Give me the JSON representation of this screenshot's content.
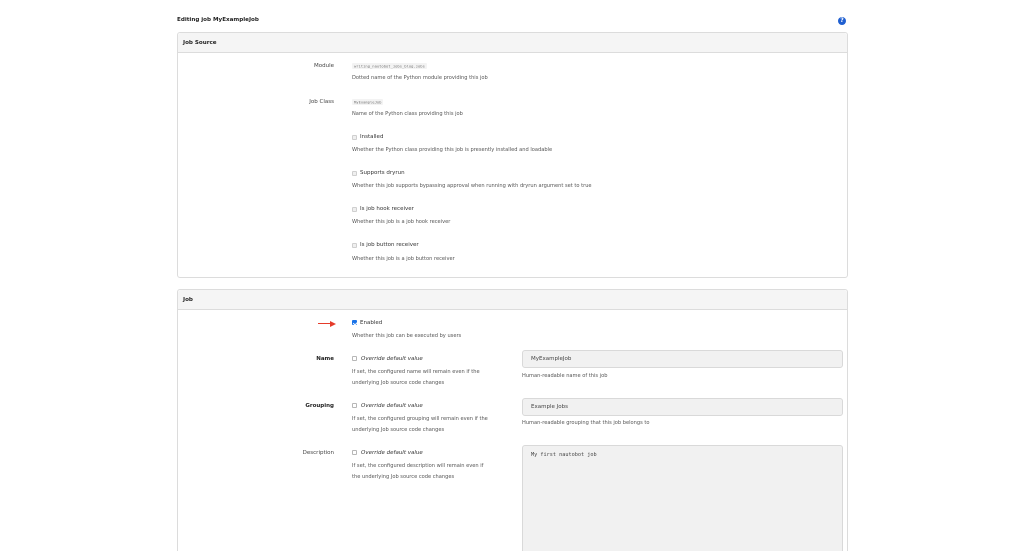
{
  "page": {
    "title": "Editing job MyExampleJob",
    "help_icon": "question-icon"
  },
  "job_source": {
    "heading": "Job Source",
    "module": {
      "label": "Module",
      "value": "writing_nautobot_jobs_blog.jobs",
      "help": "Dotted name of the Python module providing this job"
    },
    "job_class": {
      "label": "Job Class",
      "value": "MyExampleJob",
      "help": "Name of the Python class providing this job"
    },
    "installed": {
      "label": "Installed",
      "checked": false,
      "help": "Whether the Python class providing this job is presently installed and loadable"
    },
    "supports_dryrun": {
      "label": "Supports dryrun",
      "checked": false,
      "help": "Whether this job supports bypassing approval when running with dryrun argument set to true"
    },
    "is_job_hook_receiver": {
      "label": "Is job hook receiver",
      "checked": false,
      "help": "Whether this job is a job hook receiver"
    },
    "is_job_button_receiver": {
      "label": "Is job button receiver",
      "checked": false,
      "help": "Whether this job is a job button receiver"
    }
  },
  "job": {
    "heading": "Job",
    "enabled": {
      "label": "Enabled",
      "checked": true,
      "help": "Whether this job can be executed by users"
    },
    "name": {
      "label": "Name",
      "override_label": "Override default value",
      "override_help_line1": "If set, the configured name will remain even if the",
      "override_help_line2": "underlying Job source code changes",
      "value": "MyExampleJob",
      "help": "Human-readable name of this job"
    },
    "grouping": {
      "label": "Grouping",
      "override_label": "Override default value",
      "override_help_line1": "If set, the configured grouping will remain even if the",
      "override_help_line2": "underlying Job source code changes",
      "value": "Example Jobs",
      "help": "Human-readable grouping that this job belongs to"
    },
    "description": {
      "label": "Description",
      "override_label": "Override default value",
      "override_help_line1": "If set, the configured description will remain even if",
      "override_help_line2": "the underlying Job source code changes",
      "value": "My first nautobot job"
    }
  },
  "annotation": {
    "arrow_color": "#e53b2a",
    "arrow_icon": "red-arrow-right-icon"
  },
  "colors": {
    "accent": "#1a73e8",
    "panel_heading_bg": "#f5f5f5"
  }
}
